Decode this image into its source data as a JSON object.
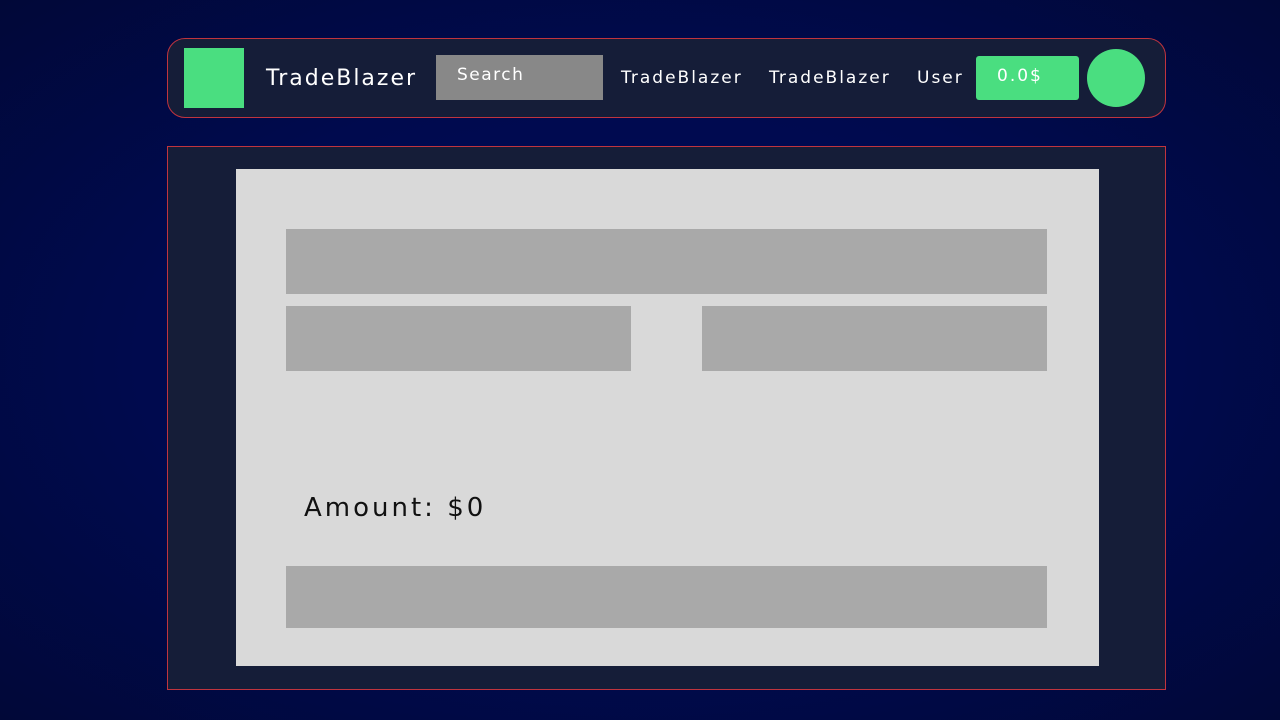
{
  "header": {
    "brand": "TradeBlazer",
    "search_placeholder": "Search",
    "links": [
      "TradeBlazer",
      "TradeBlazer",
      "User"
    ],
    "balance": "0.0$"
  },
  "form": {
    "amount_label": "Amount: $0"
  },
  "colors": {
    "accent": "#4ade80",
    "panel_bg": "#151d38",
    "border": "#c0343e",
    "field": "#a9a9a9",
    "card": "#d9d9d9"
  },
  "icons": {
    "logo": "logo-square",
    "avatar": "user-avatar-circle"
  }
}
